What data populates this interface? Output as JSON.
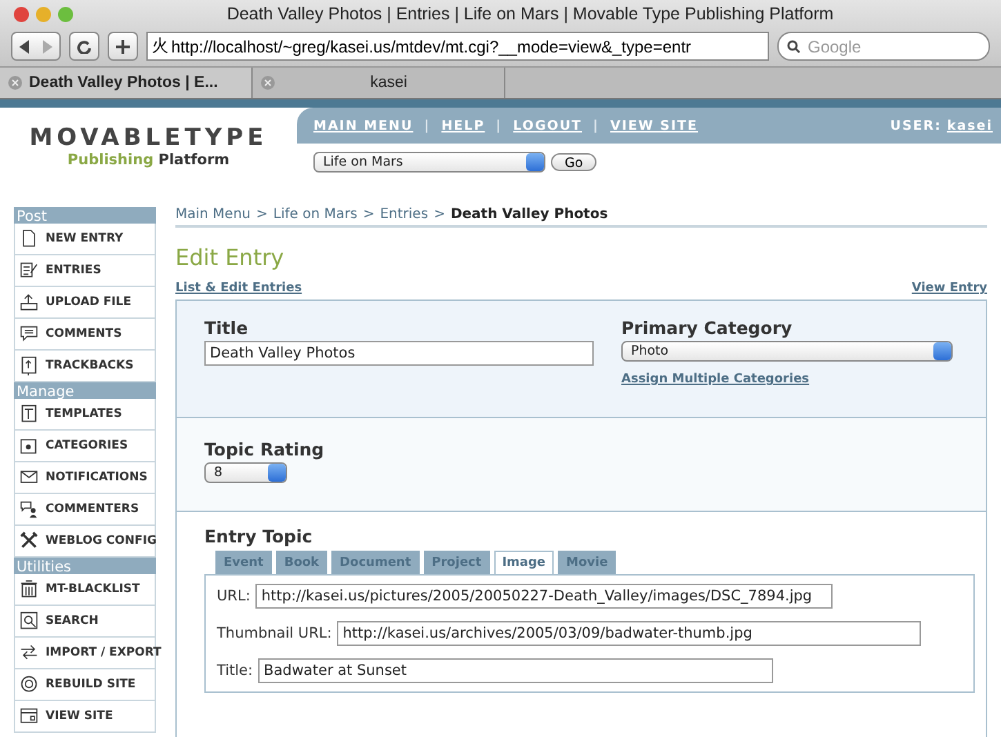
{
  "window": {
    "title": "Death Valley Photos | Entries | Life on Mars | Movable Type Publishing Platform"
  },
  "toolbar": {
    "address": "http://localhost/~greg/kasei.us/mtdev/mt.cgi?__mode=view&_type=entr",
    "address_glyph": "火",
    "search_placeholder": "Google"
  },
  "browser_tabs": [
    {
      "label": "Death Valley Photos | E...",
      "selected": true
    },
    {
      "label": "kasei",
      "selected": false
    }
  ],
  "logo": {
    "name": "MOVABLETYPE",
    "tagline_a": "Publishing",
    "tagline_b": "Platform"
  },
  "nav": {
    "links": [
      "MAIN MENU",
      "HELP",
      "LOGOUT",
      "VIEW SITE"
    ],
    "separator": "|",
    "user_label": "USER:",
    "user": "kasei",
    "blog": "Life on Mars",
    "go": "Go"
  },
  "sidebar": [
    {
      "heading": "Post",
      "items": [
        "NEW ENTRY",
        "ENTRIES",
        "UPLOAD FILE",
        "COMMENTS",
        "TRACKBACKS"
      ]
    },
    {
      "heading": "Manage",
      "items": [
        "TEMPLATES",
        "CATEGORIES",
        "NOTIFICATIONS",
        "COMMENTERS",
        "WEBLOG CONFIG"
      ]
    },
    {
      "heading": "Utilities",
      "items": [
        "MT-BLACKLIST",
        "SEARCH",
        "IMPORT / EXPORT",
        "REBUILD SITE",
        "VIEW SITE"
      ]
    }
  ],
  "breadcrumb": {
    "links": [
      "Main Menu",
      "Life on Mars",
      "Entries"
    ],
    "separator": ">",
    "current": "Death Valley Photos"
  },
  "page_title": "Edit Entry",
  "list_link": "List & Edit Entries",
  "view_link": "View Entry",
  "title_field": {
    "label": "Title",
    "value": "Death Valley Photos"
  },
  "category": {
    "label": "Primary Category",
    "value": "Photo",
    "link": "Assign Multiple Categories"
  },
  "rating": {
    "label": "Topic Rating",
    "value": "8"
  },
  "entry_topic": {
    "label": "Entry Topic",
    "tabs": [
      {
        "label": "Event",
        "selected": false
      },
      {
        "label": "Book",
        "selected": false
      },
      {
        "label": "Document",
        "selected": false
      },
      {
        "label": "Project",
        "selected": false
      },
      {
        "label": "Image",
        "selected": true
      },
      {
        "label": "Movie",
        "selected": false
      }
    ],
    "fields": [
      {
        "label": "URL:",
        "value": "http://kasei.us/pictures/2005/20050227-Death_Valley/images/DSC_7894.jpg"
      },
      {
        "label": "Thumbnail URL:",
        "value": "http://kasei.us/archives/2005/03/09/badwater-thumb.jpg"
      },
      {
        "label": "Title:",
        "value": "Badwater at Sunset"
      }
    ]
  }
}
